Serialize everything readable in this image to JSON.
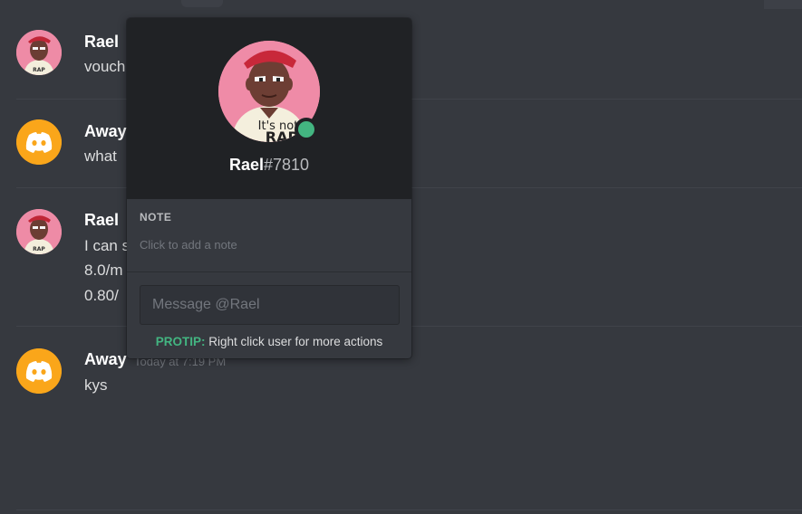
{
  "messages": [
    {
      "author": "Rael",
      "avatar": "rael-avatar",
      "lines": [
        "vouch"
      ]
    },
    {
      "author": "Away",
      "avatar": "discord-logo-avatar",
      "lines": [
        "what"
      ]
    },
    {
      "author": "Rael",
      "avatar": "rael-avatar",
      "lines": [
        "I can s",
        "8.0/m",
        "0.80/"
      ]
    },
    {
      "author": "Away",
      "avatar": "discord-logo-avatar",
      "timestamp": "Today at 7:19 PM",
      "lines": [
        "kys"
      ]
    }
  ],
  "popout": {
    "username": "Rael",
    "discriminator": "#7810",
    "status": "online",
    "status_color": "#43b581",
    "note_label": "NOTE",
    "note_placeholder": "Click to add a note",
    "message_placeholder": "Message @Rael",
    "protip_label": "PROTIP:",
    "protip_text": "Right click user for more actions"
  },
  "colors": {
    "background": "#36393f",
    "popout_header": "#202225",
    "discord_avatar": "#faa61a",
    "accent_green": "#43b581"
  }
}
